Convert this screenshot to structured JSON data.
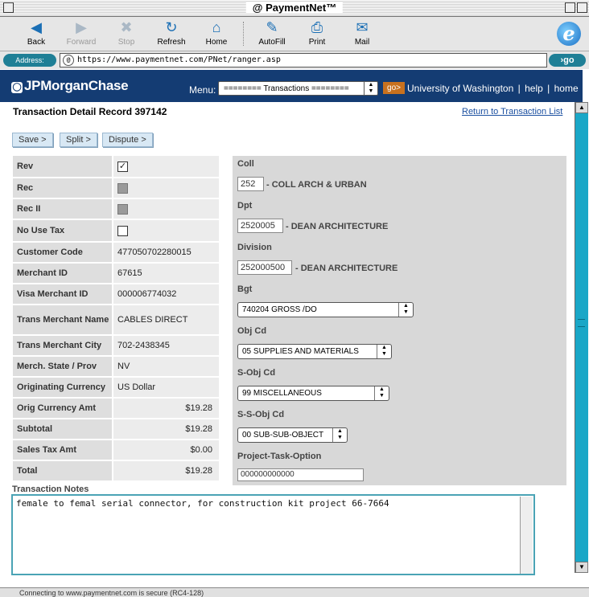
{
  "window": {
    "title": "@ PaymentNet™"
  },
  "toolbar": {
    "buttons": [
      {
        "label": "Back",
        "icon": "back-arrow-icon",
        "glyph": "◀",
        "enabled": true
      },
      {
        "label": "Forward",
        "icon": "forward-arrow-icon",
        "glyph": "▶",
        "enabled": false
      },
      {
        "label": "Stop",
        "icon": "stop-icon",
        "glyph": "✖",
        "enabled": false
      },
      {
        "label": "Refresh",
        "icon": "refresh-icon",
        "glyph": "↻",
        "enabled": true
      },
      {
        "label": "Home",
        "icon": "home-icon",
        "glyph": "⌂",
        "enabled": true
      },
      {
        "label": "AutoFill",
        "icon": "autofill-icon",
        "glyph": "✎",
        "enabled": true
      },
      {
        "label": "Print",
        "icon": "print-icon",
        "glyph": "⎙",
        "enabled": true
      },
      {
        "label": "Mail",
        "icon": "mail-icon",
        "glyph": "✉",
        "enabled": true
      }
    ],
    "ie_logo": "e"
  },
  "address": {
    "label": "Address:",
    "url": "https://www.paymentnet.com/PNet/ranger.asp",
    "go": "go"
  },
  "header": {
    "logo": "JPMorganChase",
    "menu_label": "Menu:",
    "menu_value": "======== Transactions ========",
    "go": "go>",
    "links": [
      "University of Washington",
      "|",
      "help",
      "|",
      "home"
    ]
  },
  "page": {
    "title": "Transaction Detail Record 397142",
    "return_link": "Return to Transaction List",
    "actions": [
      "Save >",
      "Split >",
      "Dispute >"
    ]
  },
  "details": [
    {
      "label": "Rev",
      "type": "checkbox",
      "checked": true
    },
    {
      "label": "Rec",
      "type": "checkbox-disabled"
    },
    {
      "label": "Rec II",
      "type": "checkbox-disabled"
    },
    {
      "label": "No Use Tax",
      "type": "checkbox",
      "checked": false
    },
    {
      "label": "Customer Code",
      "value": "477050702280015"
    },
    {
      "label": "Merchant ID",
      "value": "67615"
    },
    {
      "label": "Visa Merchant ID",
      "value": "000006774032"
    },
    {
      "label": "Trans Merchant Name",
      "value": "CABLES DIRECT"
    },
    {
      "label": "Trans Merchant City",
      "value": "702-2438345"
    },
    {
      "label": "Merch. State / Prov",
      "value": "NV"
    },
    {
      "label": "Originating Currency",
      "value": "US Dollar"
    },
    {
      "label": "Orig Currency Amt",
      "value": "$19.28",
      "num": true
    },
    {
      "label": "Subtotal",
      "value": "$19.28",
      "num": true
    },
    {
      "label": "Sales Tax Amt",
      "value": "$0.00",
      "num": true
    },
    {
      "label": "Total",
      "value": "$19.28",
      "num": true
    }
  ],
  "accounting": {
    "coll": {
      "label": "Coll",
      "value": "252",
      "desc": "- COLL ARCH & URBAN"
    },
    "dpt": {
      "label": "Dpt",
      "value": "2520005",
      "desc": "- DEAN ARCHITECTURE"
    },
    "division": {
      "label": "Division",
      "value": "252000500",
      "desc": "- DEAN ARCHITECTURE"
    },
    "bgt": {
      "label": "Bgt",
      "value": "740204 GROSS /DO"
    },
    "obj_cd": {
      "label": "Obj Cd",
      "value": "05 SUPPLIES AND MATERIALS"
    },
    "s_obj_cd": {
      "label": "S-Obj Cd",
      "value": "99 MISCELLANEOUS"
    },
    "s_s_obj_cd": {
      "label": "S-S-Obj Cd",
      "value": "00 SUB-SUB-OBJECT"
    },
    "project": {
      "label": "Project-Task-Option",
      "value": "000000000000"
    }
  },
  "notes": {
    "label": "Transaction Notes",
    "text": "female to femal serial connector, for construction kit project 66-7664"
  },
  "status": {
    "text": "Connecting to www.paymentnet.com is secure (RC4-128)"
  }
}
